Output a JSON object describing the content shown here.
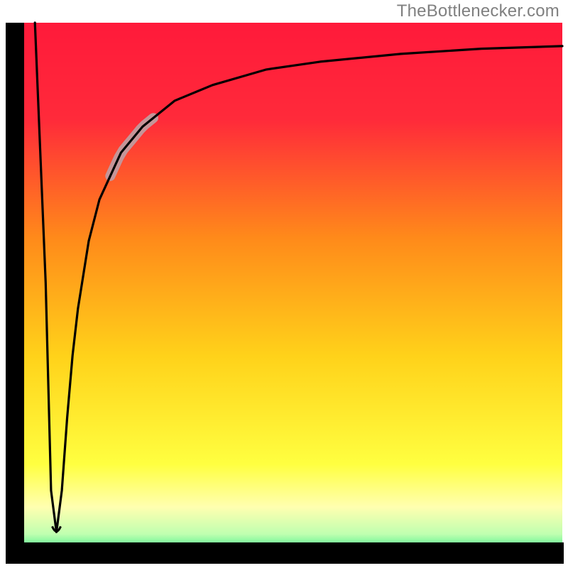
{
  "attribution": "TheBottlenecker.com",
  "colors": {
    "frame": "#000000",
    "curve": "#000000",
    "highlight": "#c59598",
    "gradient_top": "#ff1a3a",
    "gradient_mid1": "#ff7a1a",
    "gradient_mid2": "#ffd21a",
    "gradient_mid3": "#ffff66",
    "gradient_bottom": "#00e676"
  },
  "chart_data": {
    "type": "line",
    "title": "",
    "xlabel": "",
    "ylabel": "",
    "xlim": [
      0,
      100
    ],
    "ylim": [
      0,
      100
    ],
    "grid": false,
    "legend": false,
    "note": "Axes are unlabeled in the source image; values below are pixel-position estimates normalized to 0–100 on both axes, matching the visual shape of the curve.",
    "series": [
      {
        "name": "bottleneck-curve",
        "x": [
          2,
          4,
          5,
          6,
          7,
          8,
          9,
          10,
          12,
          14,
          18,
          22,
          28,
          35,
          45,
          55,
          70,
          85,
          100
        ],
        "values": [
          100,
          50,
          10,
          2,
          10,
          24,
          36,
          45,
          58,
          66,
          75,
          80,
          85,
          88,
          91,
          92.5,
          94,
          95,
          95.5
        ]
      }
    ],
    "highlight_segment": {
      "series": "bottleneck-curve",
      "x_start": 16,
      "x_end": 24,
      "note": "Pale thick segment overlaid on the curve"
    },
    "background_gradient": {
      "orientation": "vertical",
      "stops": [
        {
          "pos": 0.0,
          "desc": "red"
        },
        {
          "pos": 0.4,
          "desc": "orange"
        },
        {
          "pos": 0.7,
          "desc": "yellow"
        },
        {
          "pos": 0.92,
          "desc": "pale-yellow"
        },
        {
          "pos": 1.0,
          "desc": "green"
        }
      ]
    }
  }
}
